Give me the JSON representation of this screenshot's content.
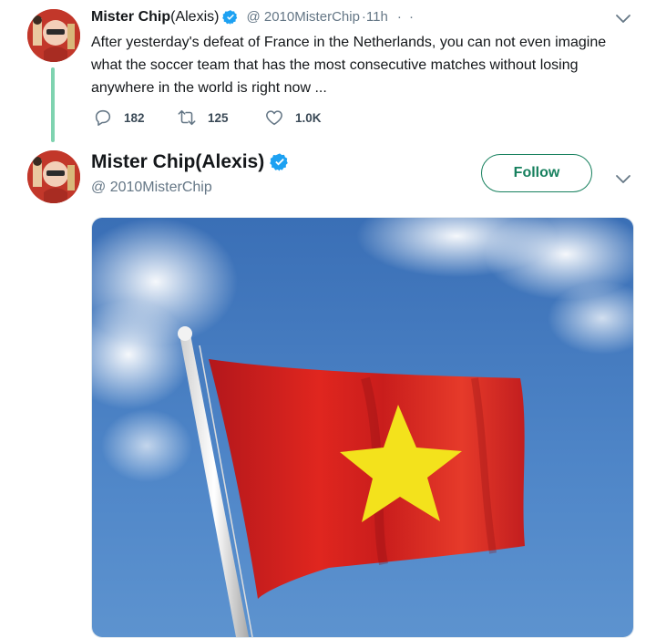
{
  "tweet": {
    "author_name_bold": "Mister Chip",
    "author_name_rest": "(Alexis)",
    "handle": "@ 2010MisterChip",
    "time": "·11h",
    "more": "· ·",
    "text": "After yesterday's defeat of France in the Netherlands, you can not even imagine what the soccer team that has the most consecutive matches without losing anywhere in the world is right now ...",
    "replies": "182",
    "retweets": "125",
    "likes": "1.0K"
  },
  "profile_card": {
    "name": "Mister Chip(Alexis)",
    "handle": "@ 2010MisterChip",
    "follow_label": "Follow"
  },
  "colors": {
    "thread_line": "#7fd3b0",
    "verified_blue": "#1da1f2",
    "follow_green": "#17805e",
    "muted_text": "#657786"
  },
  "icons": {
    "reply": "reply-icon",
    "retweet": "retweet-icon",
    "like": "heart-icon",
    "caret": "chevron-down-icon",
    "verified": "verified-badge-icon"
  }
}
